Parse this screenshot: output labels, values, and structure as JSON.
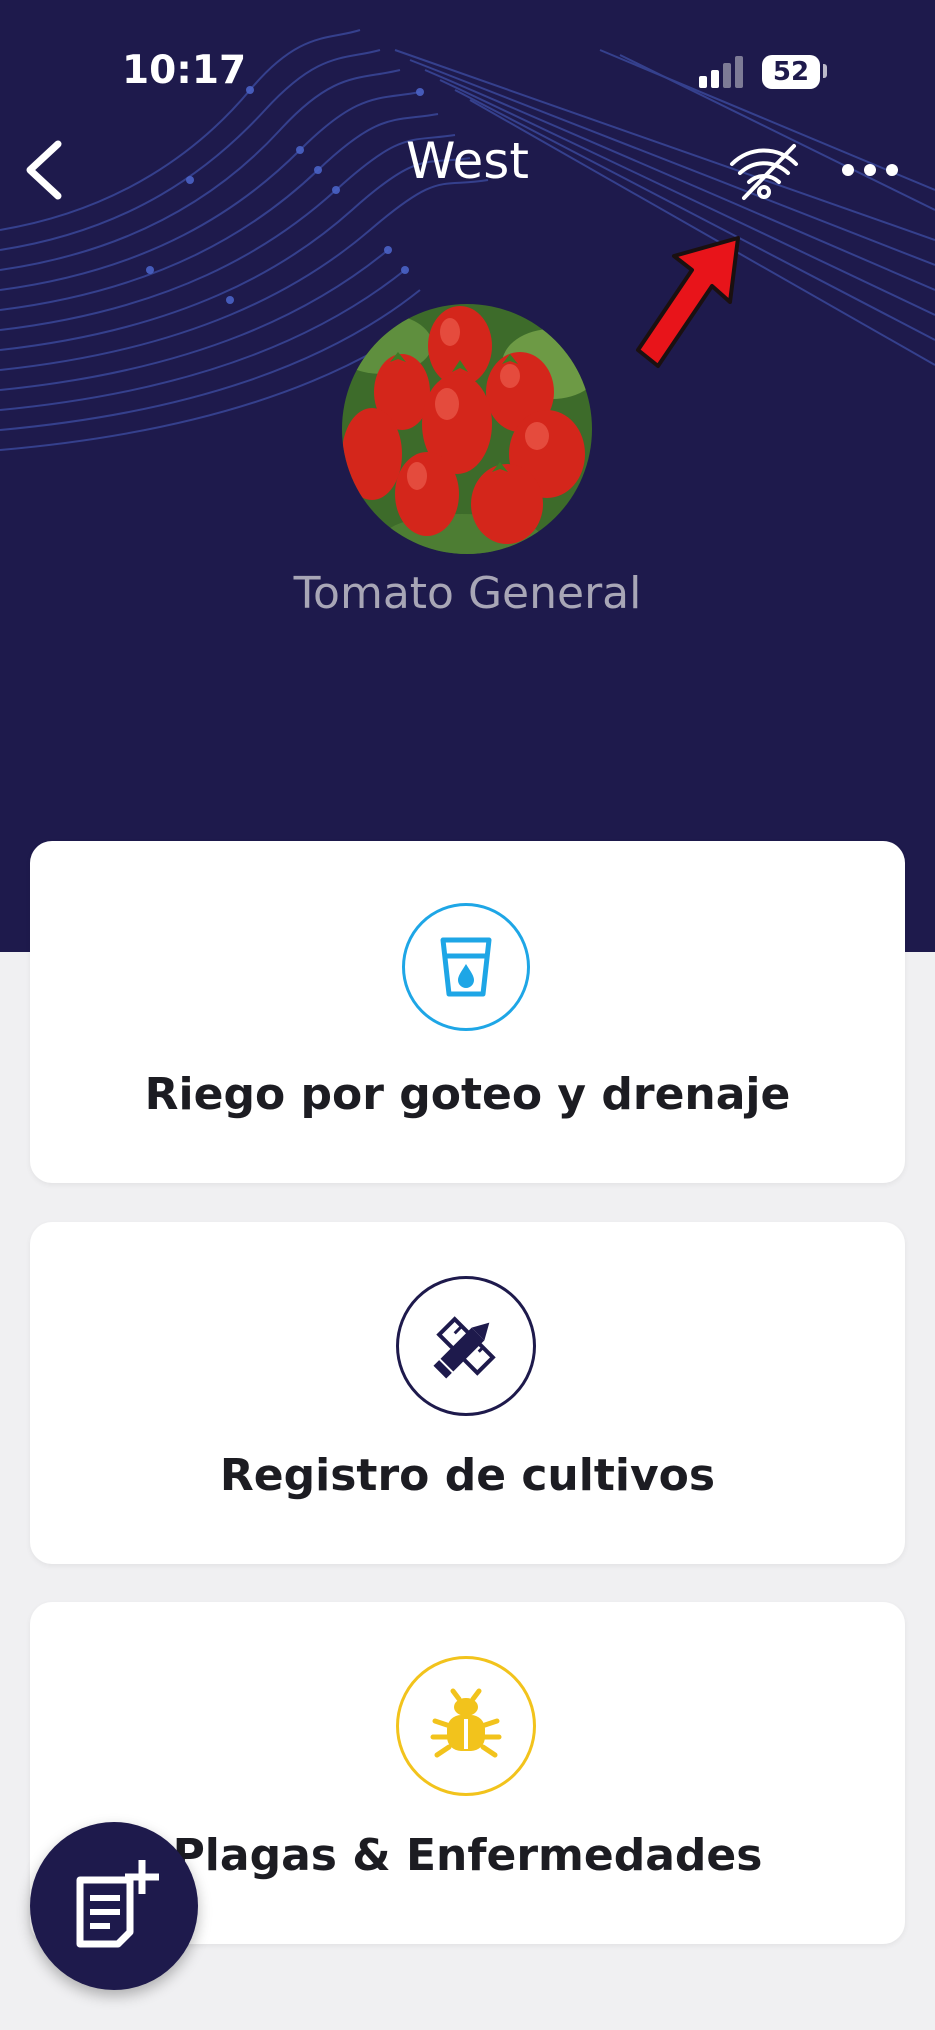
{
  "status_bar": {
    "time": "10:17",
    "battery": "52"
  },
  "header": {
    "title": "West",
    "crop_name": "Tomato General",
    "icons": {
      "back": "chevron-left-icon",
      "wifi": "wifi-off-icon",
      "more": "more-horizontal-icon"
    }
  },
  "cards": [
    {
      "label": "Riego por goteo y drenaje",
      "icon": "water-glass-icon",
      "color": "#1ea6e6"
    },
    {
      "label": "Registro de cultivos",
      "icon": "pencil-ruler-icon",
      "color": "#1e1a4c"
    },
    {
      "label": "Plagas & Enfermedades",
      "icon": "bug-icon",
      "color": "#f2c31c"
    }
  ],
  "fab": {
    "icon": "note-add-icon"
  },
  "colors": {
    "header_bg": "#1e1a4c",
    "background": "#f0f0f2",
    "annotation_arrow": "#e8141a"
  }
}
